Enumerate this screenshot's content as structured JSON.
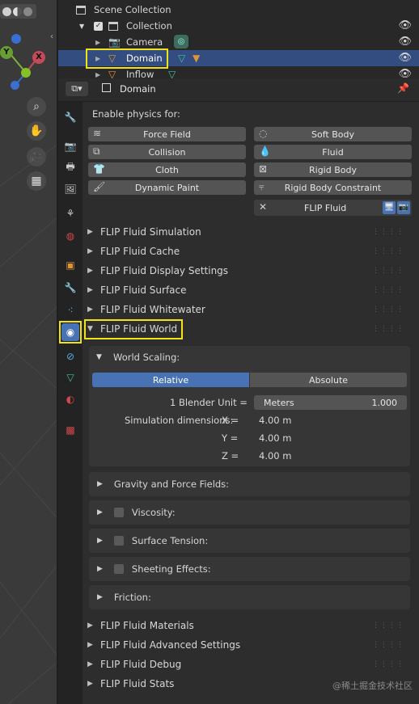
{
  "outliner": {
    "scene_collection": "Scene Collection",
    "collection": "Collection",
    "camera": "Camera",
    "domain": "Domain",
    "inflow": "Inflow"
  },
  "header": {
    "object_name": "Domain"
  },
  "physics": {
    "title": "Enable physics for:",
    "buttons_left": [
      "Force Field",
      "Collision",
      "Cloth",
      "Dynamic Paint"
    ],
    "buttons_right": [
      "Soft Body",
      "Fluid",
      "Rigid Body",
      "Rigid Body Constraint"
    ],
    "flip_fluid": "FLIP Fluid"
  },
  "panels_top": [
    "FLIP Fluid Simulation",
    "FLIP Fluid Cache",
    "FLIP Fluid Display Settings",
    "FLIP Fluid Surface",
    "FLIP Fluid Whitewater"
  ],
  "world": {
    "title": "FLIP Fluid World",
    "scaling_title": "World Scaling:",
    "mode_relative": "Relative",
    "mode_absolute": "Absolute",
    "blender_unit_label": "1 Blender Unit =",
    "unit_name": "Meters",
    "unit_value": "1.000",
    "sim_dim_label": "Simulation dimensions:",
    "x_label": "X =",
    "y_label": "Y =",
    "z_label": "Z =",
    "x_value": "4.00 m",
    "y_value": "4.00 m",
    "z_value": "4.00 m",
    "sections": [
      "Gravity and Force Fields:",
      "Viscosity:",
      "Surface Tension:",
      "Sheeting Effects:",
      "Friction:"
    ]
  },
  "panels_bottom": [
    "FLIP Fluid Materials",
    "FLIP Fluid Advanced Settings",
    "FLIP Fluid Debug",
    "FLIP Fluid Stats"
  ],
  "watermark": "@稀土掘金技术社区",
  "colors": {
    "selected_row": "#334d80",
    "highlight": "#f1e31a",
    "active_tab": "#4772b3"
  }
}
